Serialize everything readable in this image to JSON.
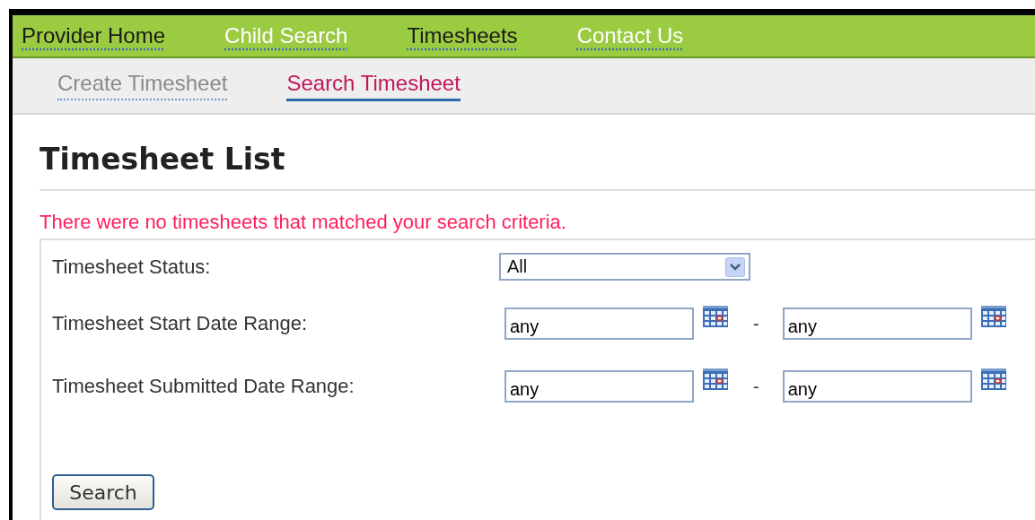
{
  "nav": [
    {
      "label": "Provider Home",
      "highlighted": true
    },
    {
      "label": "Child Search",
      "highlighted": false
    },
    {
      "label": "Timesheets",
      "highlighted": true
    },
    {
      "label": "Contact Us",
      "highlighted": false
    }
  ],
  "subtabs": [
    {
      "label": "Create Timesheet",
      "selected": false
    },
    {
      "label": "Search Timesheet",
      "selected": true
    }
  ],
  "title": "Timesheet List",
  "error": "There were no timesheets that matched your search criteria.",
  "form": {
    "status": {
      "label": "Timesheet Status:",
      "value": "All"
    },
    "ranges": [
      {
        "label": "Timesheet Start Date Range:",
        "from": "any",
        "separator": "-",
        "to": "any"
      },
      {
        "label": "Timesheet Submitted Date Range:",
        "from": "any",
        "separator": "-",
        "to": "any"
      }
    ],
    "button": "Search"
  }
}
